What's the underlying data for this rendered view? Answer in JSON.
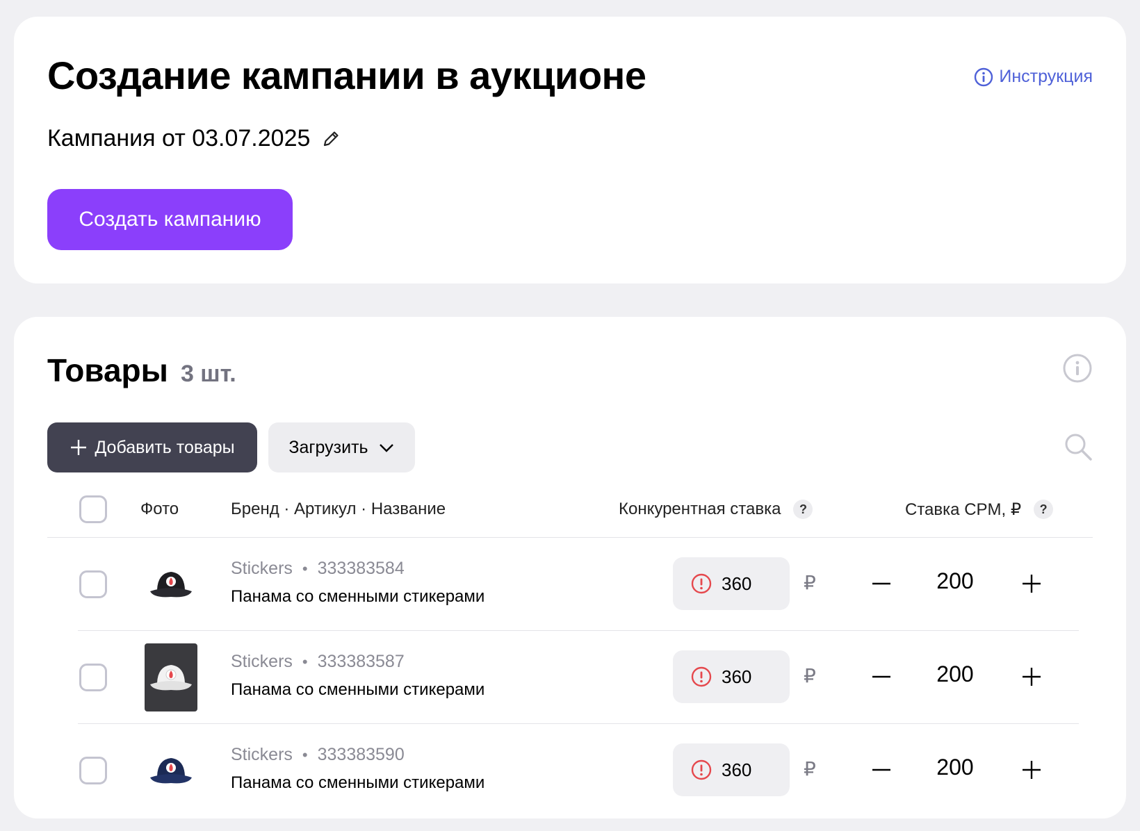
{
  "header": {
    "title": "Создание кампании в аукционе",
    "instruction_link": "Инструкция",
    "campaign_name": "Кампания от 03.07.2025",
    "create_button": "Создать кампанию"
  },
  "goods": {
    "title": "Товары",
    "count": "3 шт.",
    "add_button": "Добавить товары",
    "load_button": "Загрузить",
    "columns": {
      "photo": "Фото",
      "name": "Бренд · Артикул · Название",
      "competitive_bid": "Конкурентная ставка",
      "cpm_bid": "Ставка CPM, ₽",
      "help_mark": "?"
    },
    "rows": [
      {
        "brand": "Stickers",
        "article": "333383584",
        "name": "Панама со сменными стикерами",
        "competitive_bid": "360",
        "currency": "₽",
        "cpm": "200",
        "photo_color": "black"
      },
      {
        "brand": "Stickers",
        "article": "333383587",
        "name": "Панама со сменными стикерами",
        "competitive_bid": "360",
        "currency": "₽",
        "cpm": "200",
        "photo_color": "white"
      },
      {
        "brand": "Stickers",
        "article": "333383590",
        "name": "Панама со сменными стикерами",
        "competitive_bid": "360",
        "currency": "₽",
        "cpm": "200",
        "photo_color": "navy"
      }
    ],
    "separator_dot": "•"
  },
  "colors": {
    "accent": "#8b3ffb",
    "link": "#4f61d8",
    "dark_button": "#424251",
    "warning": "#e5484d"
  }
}
